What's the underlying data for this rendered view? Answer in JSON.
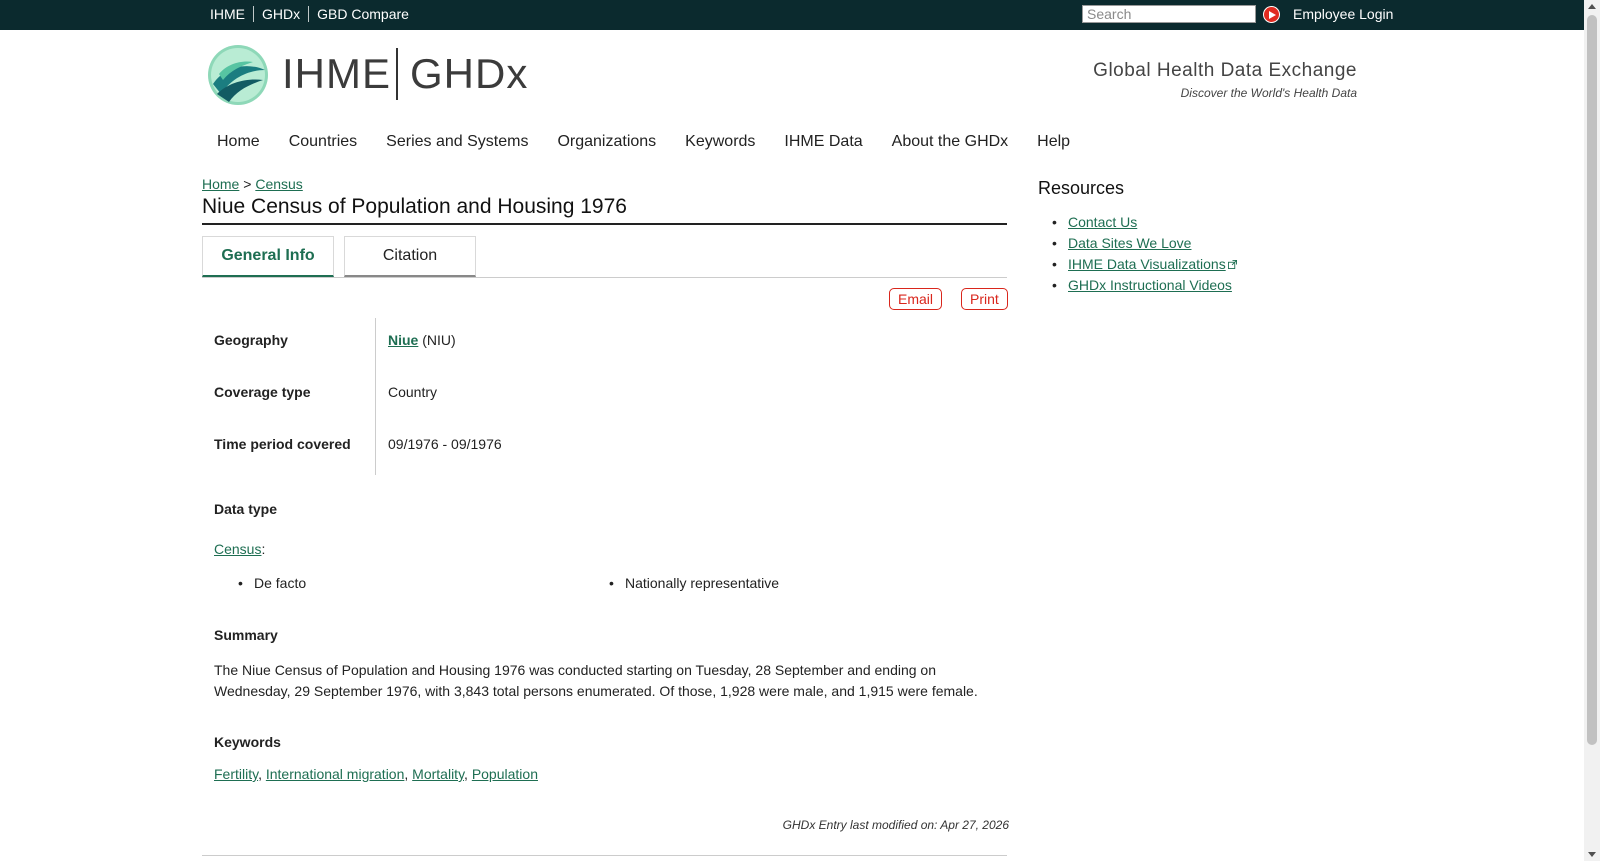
{
  "topbar": {
    "links": [
      "IHME",
      "GHDx",
      "GBD Compare"
    ],
    "search_placeholder": "Search",
    "employee_login": "Employee Login"
  },
  "header": {
    "brand_left": "IHME",
    "brand_right": "GHDx",
    "tagline_title": "Global Health Data Exchange",
    "tagline_sub": "Discover the World's Health Data"
  },
  "nav": {
    "items": [
      "Home",
      "Countries",
      "Series and Systems",
      "Organizations",
      "Keywords",
      "IHME Data",
      "About the GHDx",
      "Help"
    ]
  },
  "breadcrumb": {
    "home": "Home",
    "separator": ">",
    "current": "Census"
  },
  "page": {
    "title": "Niue Census of Population and Housing 1976",
    "tabs": {
      "general": "General Info",
      "citation": "Citation"
    },
    "email_label": "Email",
    "print_label": "Print",
    "info": {
      "geography_label": "Geography",
      "geography_link": "Niue",
      "geography_code": "(NIU)",
      "coverage_label": "Coverage type",
      "coverage_value": "Country",
      "time_label": "Time period covered",
      "time_value": "09/1976 - 09/1976"
    },
    "data_type": {
      "heading": "Data type",
      "link": "Census",
      "suffix": ":",
      "items": [
        "De facto",
        "Nationally representative"
      ]
    },
    "summary": {
      "heading": "Summary",
      "text": "The Niue Census of Population and Housing 1976 was conducted starting on Tuesday, 28 September and ending on Wednesday, 29 September 1976, with 3,843 total persons enumerated. Of those, 1,928 were male, and 1,915 were female."
    },
    "keywords": {
      "heading": "Keywords",
      "items": [
        "Fertility",
        "International migration",
        "Mortality",
        "Population"
      ],
      "separator": ", "
    },
    "modified": "GHDx Entry last modified on: Apr 27, 2026"
  },
  "sidebar": {
    "title": "Resources",
    "items": [
      "Contact Us",
      "Data Sites We Love",
      "IHME Data Visualizations",
      "GHDx Instructional Videos"
    ]
  },
  "colors": {
    "topbar_bg": "#0b2a2e",
    "link": "#1e6e52",
    "accent_red": "#d9261c"
  }
}
